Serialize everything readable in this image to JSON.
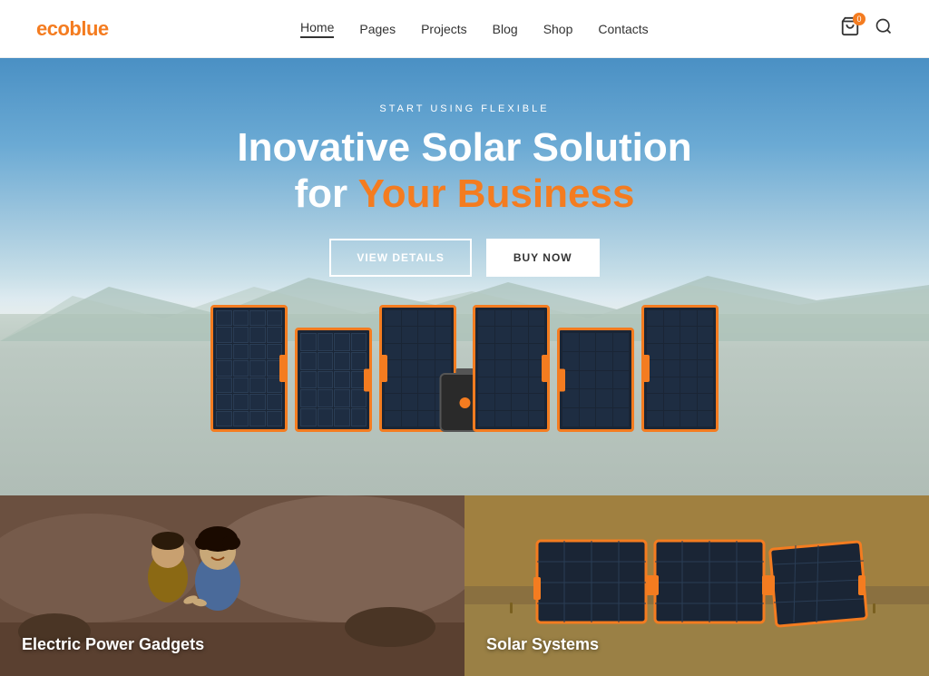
{
  "brand": {
    "name_part1": "eco",
    "name_part2": "blue"
  },
  "nav": {
    "items": [
      {
        "label": "Home",
        "active": true
      },
      {
        "label": "Pages",
        "active": false
      },
      {
        "label": "Projects",
        "active": false
      },
      {
        "label": "Blog",
        "active": false
      },
      {
        "label": "Shop",
        "active": false
      },
      {
        "label": "Contacts",
        "active": false
      }
    ]
  },
  "cart": {
    "badge": "0"
  },
  "hero": {
    "eyebrow": "START USING FLEXIBLE",
    "title_line1": "Inovative Solar Solution",
    "title_line2_prefix": "for ",
    "title_line2_highlight": "Your Business",
    "btn_view": "VIEW DETAILS",
    "btn_buy": "BUY NOW"
  },
  "cards": [
    {
      "label": "Electric Power Gadgets"
    },
    {
      "label": "Solar Systems"
    }
  ],
  "colors": {
    "orange": "#f47c20",
    "dark": "#222",
    "white": "#ffffff"
  }
}
